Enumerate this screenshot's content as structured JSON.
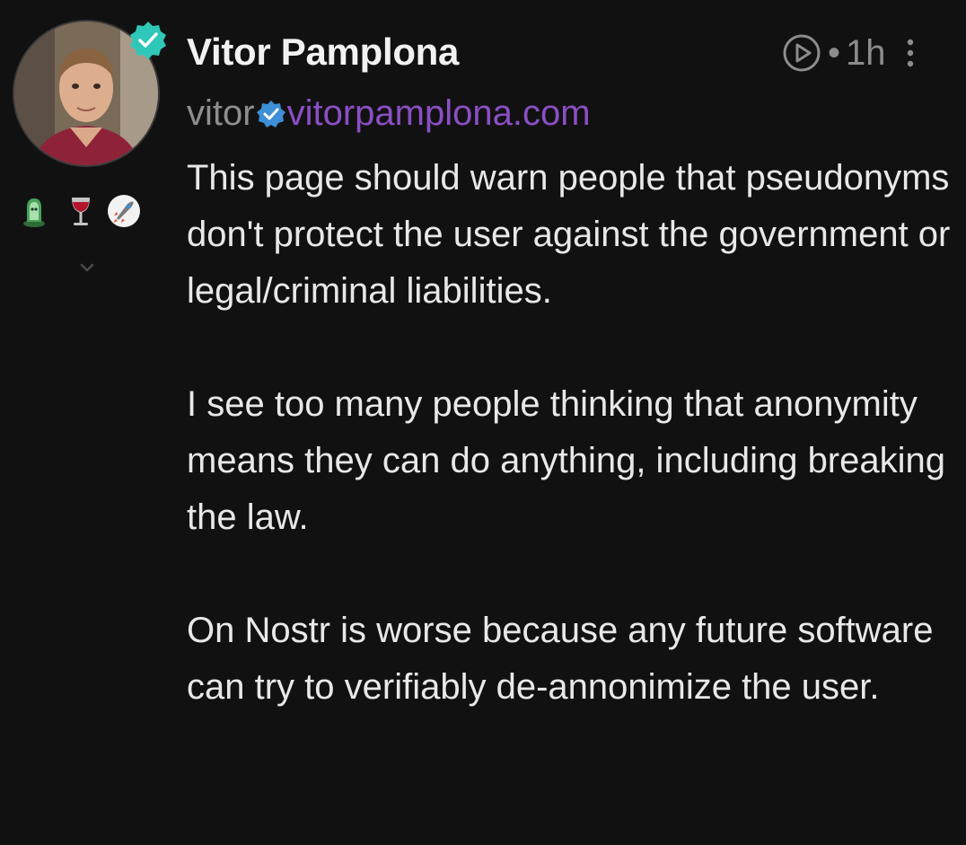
{
  "post": {
    "author": {
      "name": "Vitor Pamplona",
      "handle_user": "vitor",
      "handle_domain": "vitorpamplona.com",
      "verified": true
    },
    "timestamp": "1h",
    "separator": "•",
    "paragraphs": [
      "This page should warn people that pseudonyms don't protect the user against the government or legal/criminal liabilities.",
      "I see too many people thinking that anonymity means they can do anything, including breaking the law.",
      "On Nostr is worse because any future software can try to verifiably de-annonimize the user."
    ],
    "badges": [
      "ghost-badge-icon",
      "wine-glass-badge-icon",
      "rocket-badge-icon"
    ]
  },
  "colors": {
    "background": "#121112",
    "text": "#e8e8e8",
    "muted": "#8e8e8e",
    "domain": "#8a4fc4",
    "verified": "#2fc7b8",
    "nip05": "#3d8fd6"
  }
}
